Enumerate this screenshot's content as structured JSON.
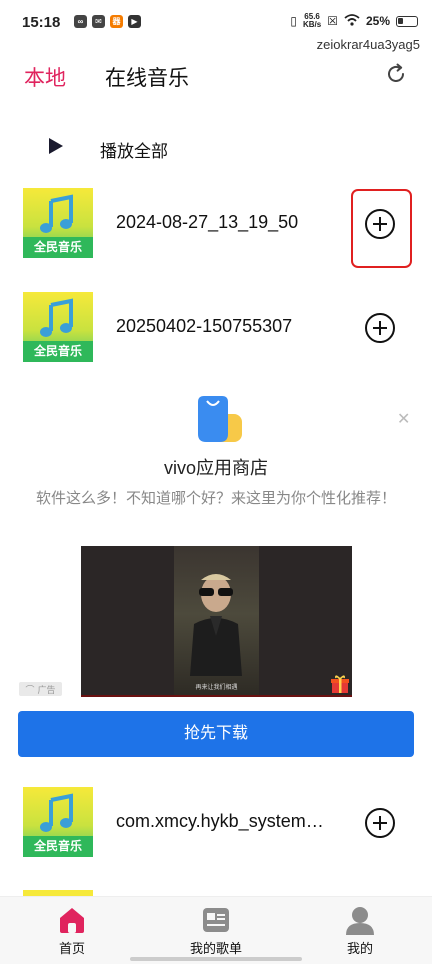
{
  "status_bar": {
    "time": "15:18",
    "speed": "65.6",
    "speed_unit": "KB/s",
    "battery": "25%",
    "username": "zeiokrar4ua3yag5"
  },
  "header": {
    "tab_local": "本地",
    "tab_online": "在线音乐",
    "accent_color": "#e0245e"
  },
  "play_all": {
    "label": "播放全部"
  },
  "cover_caption": "全民音乐",
  "songs": [
    {
      "title": "2024-08-27_13_19_50"
    },
    {
      "title": "20250402-150755307"
    },
    {
      "title": "com.xmcy.hykb_system…"
    }
  ],
  "ad": {
    "app_name": "vivo应用商店",
    "description": "软件这么多！不知道哪个好？来这里为你个性化推荐！",
    "video_caption": "再来让我们相遇",
    "badge": "广告",
    "button_label": "抢先下载",
    "button_color": "#1e73e8"
  },
  "bottom_nav": [
    {
      "label": "首页",
      "icon": "home-icon"
    },
    {
      "label": "我的歌单",
      "icon": "playlist-icon"
    },
    {
      "label": "我的",
      "icon": "person-icon"
    }
  ],
  "highlight_color": "#e02020"
}
